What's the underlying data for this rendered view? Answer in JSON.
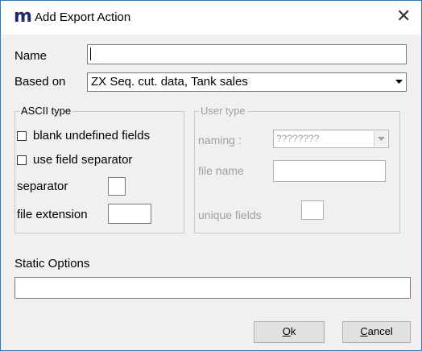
{
  "window": {
    "app_icon_letter": "m",
    "title": "Add Export Action",
    "close_glyph": "✕"
  },
  "form": {
    "name_label": "Name",
    "name_value": "",
    "based_on_label": "Based on",
    "based_on_value": "ZX Seq. cut. data, Tank sales"
  },
  "ascii_type": {
    "legend": "ASCII type",
    "blank_undefined_label": "blank undefined fields",
    "blank_undefined_checked": false,
    "use_separator_label": "use field separator",
    "use_separator_checked": false,
    "separator_label": "separator",
    "separator_value": "",
    "file_extension_label": "file extension",
    "file_extension_value": ""
  },
  "user_type": {
    "legend": "User type",
    "naming_label": "naming :",
    "naming_value": "????????",
    "file_name_label": "file name",
    "file_name_value": "",
    "unique_fields_label": "unique fields",
    "unique_fields_value": ""
  },
  "static_options": {
    "label": "Static Options",
    "value": ""
  },
  "buttons": {
    "ok_mnemonic": "O",
    "ok_rest": "k",
    "cancel_mnemonic": "C",
    "cancel_rest": "ancel"
  }
}
